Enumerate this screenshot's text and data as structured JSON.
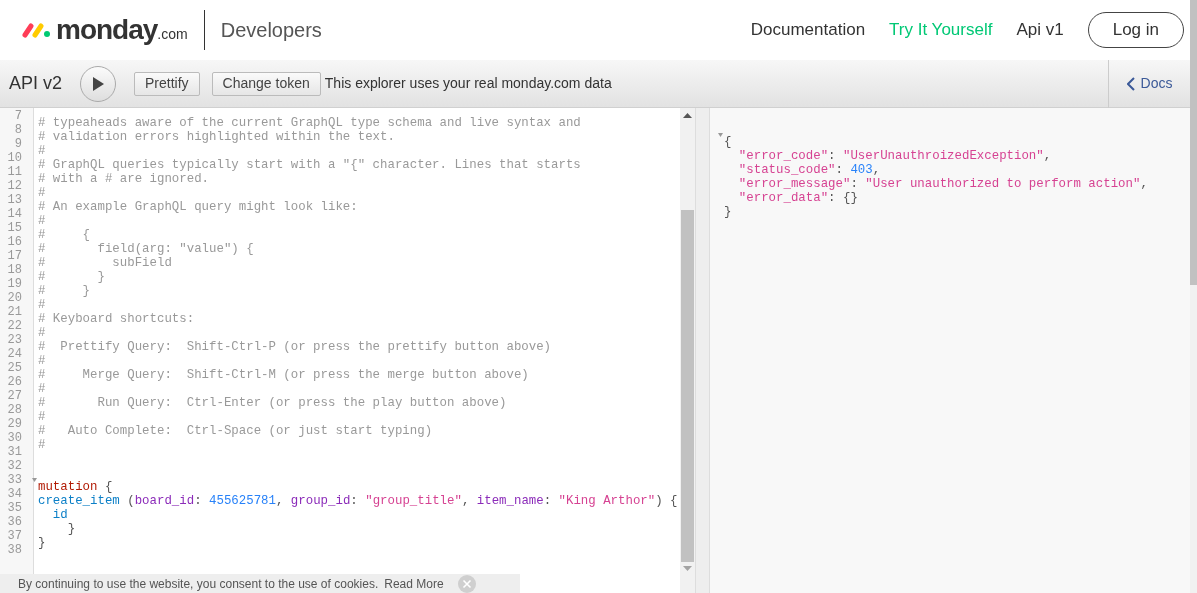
{
  "header": {
    "logo": {
      "name": "monday",
      "suffix": ".com"
    },
    "section": "Developers",
    "nav": [
      {
        "label": "Documentation",
        "selected": false
      },
      {
        "label": "Try It Yourself",
        "selected": true
      },
      {
        "label": "Api v1",
        "selected": false
      }
    ],
    "login": "Log in"
  },
  "toolbar": {
    "title": "API v2",
    "buttons": [
      "Prettify",
      "Change token"
    ],
    "notice": "This explorer uses your real monday.com data",
    "docs": "Docs"
  },
  "editor": {
    "lines": [
      {
        "number": "7",
        "fold": false,
        "tokens": [
          {
            "kind": "comment",
            "text": "# typeaheads aware of the current GraphQL type schema and live syntax and"
          }
        ]
      },
      {
        "number": "8",
        "fold": false,
        "tokens": [
          {
            "kind": "comment",
            "text": "# validation errors highlighted within the text."
          }
        ]
      },
      {
        "number": "9",
        "fold": false,
        "tokens": [
          {
            "kind": "comment",
            "text": "#"
          }
        ]
      },
      {
        "number": "10",
        "fold": false,
        "tokens": [
          {
            "kind": "comment",
            "text": "# GraphQL queries typically start with a \"{\" character. Lines that starts"
          }
        ]
      },
      {
        "number": "11",
        "fold": false,
        "tokens": [
          {
            "kind": "comment",
            "text": "# with a # are ignored."
          }
        ]
      },
      {
        "number": "12",
        "fold": false,
        "tokens": [
          {
            "kind": "comment",
            "text": "#"
          }
        ]
      },
      {
        "number": "13",
        "fold": false,
        "tokens": [
          {
            "kind": "comment",
            "text": "# An example GraphQL query might look like:"
          }
        ]
      },
      {
        "number": "14",
        "fold": false,
        "tokens": [
          {
            "kind": "comment",
            "text": "#"
          }
        ]
      },
      {
        "number": "15",
        "fold": false,
        "tokens": [
          {
            "kind": "comment",
            "text": "#     {"
          }
        ]
      },
      {
        "number": "16",
        "fold": false,
        "tokens": [
          {
            "kind": "comment",
            "text": "#       field(arg: \"value\") {"
          }
        ]
      },
      {
        "number": "17",
        "fold": false,
        "tokens": [
          {
            "kind": "comment",
            "text": "#         subField"
          }
        ]
      },
      {
        "number": "18",
        "fold": false,
        "tokens": [
          {
            "kind": "comment",
            "text": "#       }"
          }
        ]
      },
      {
        "number": "19",
        "fold": false,
        "tokens": [
          {
            "kind": "comment",
            "text": "#     }"
          }
        ]
      },
      {
        "number": "20",
        "fold": false,
        "tokens": [
          {
            "kind": "comment",
            "text": "#"
          }
        ]
      },
      {
        "number": "21",
        "fold": false,
        "tokens": [
          {
            "kind": "comment",
            "text": "# Keyboard shortcuts:"
          }
        ]
      },
      {
        "number": "22",
        "fold": false,
        "tokens": [
          {
            "kind": "comment",
            "text": "#"
          }
        ]
      },
      {
        "number": "23",
        "fold": false,
        "tokens": [
          {
            "kind": "comment",
            "text": "#  Prettify Query:  Shift-Ctrl-P (or press the prettify button above)"
          }
        ]
      },
      {
        "number": "24",
        "fold": false,
        "tokens": [
          {
            "kind": "comment",
            "text": "#"
          }
        ]
      },
      {
        "number": "25",
        "fold": false,
        "tokens": [
          {
            "kind": "comment",
            "text": "#     Merge Query:  Shift-Ctrl-M (or press the merge button above)"
          }
        ]
      },
      {
        "number": "26",
        "fold": false,
        "tokens": [
          {
            "kind": "comment",
            "text": "#"
          }
        ]
      },
      {
        "number": "27",
        "fold": false,
        "tokens": [
          {
            "kind": "comment",
            "text": "#       Run Query:  Ctrl-Enter (or press the play button above)"
          }
        ]
      },
      {
        "number": "28",
        "fold": false,
        "tokens": [
          {
            "kind": "comment",
            "text": "#"
          }
        ]
      },
      {
        "number": "29",
        "fold": false,
        "tokens": [
          {
            "kind": "comment",
            "text": "#   Auto Complete:  Ctrl-Space (or just start typing)"
          }
        ]
      },
      {
        "number": "30",
        "fold": false,
        "tokens": [
          {
            "kind": "comment",
            "text": "#"
          }
        ]
      },
      {
        "number": "31",
        "fold": false
      },
      {
        "number": "32",
        "fold": false
      },
      {
        "number": "33",
        "fold": true,
        "tokens": [
          {
            "kind": "keyword",
            "text": "mutation"
          },
          {
            "kind": "punct",
            "text": " {"
          }
        ]
      },
      {
        "number": "34",
        "fold": false,
        "tokens": [
          {
            "kind": "def",
            "text": "create_item"
          },
          {
            "kind": "punct",
            "text": " ("
          },
          {
            "kind": "attribute",
            "text": "board_id"
          },
          {
            "kind": "punct",
            "text": ": "
          },
          {
            "kind": "number",
            "text": "455625781"
          },
          {
            "kind": "punct",
            "text": ", "
          },
          {
            "kind": "attribute",
            "text": "group_id"
          },
          {
            "kind": "punct",
            "text": ": "
          },
          {
            "kind": "string",
            "text": "\"group_title\""
          },
          {
            "kind": "punct",
            "text": ", "
          },
          {
            "kind": "attribute",
            "text": "item_name"
          },
          {
            "kind": "punct",
            "text": ": "
          },
          {
            "kind": "string",
            "text": "\"King Arthor\""
          },
          {
            "kind": "punct",
            "text": ") {"
          }
        ]
      },
      {
        "number": "35",
        "fold": false,
        "tokens": [
          {
            "kind": "def",
            "text": "  id"
          }
        ]
      },
      {
        "number": "36",
        "fold": false,
        "tokens": [
          {
            "kind": "punct",
            "text": "    }"
          }
        ]
      },
      {
        "number": "37",
        "fold": false,
        "tokens": [
          {
            "kind": "punct",
            "text": "}"
          }
        ]
      },
      {
        "number": "38",
        "fold": false
      }
    ]
  },
  "result": {
    "lines": [
      {
        "fold": true,
        "tokens": [
          {
            "kind": "punct",
            "text": "{"
          }
        ]
      },
      {
        "fold": false,
        "tokens": [
          {
            "kind": "string",
            "text": "  \"error_code\""
          },
          {
            "kind": "punct",
            "text": ": "
          },
          {
            "kind": "string",
            "text": "\"UserUnauthroizedException\""
          },
          {
            "kind": "punct",
            "text": ","
          }
        ]
      },
      {
        "fold": false,
        "tokens": [
          {
            "kind": "string",
            "text": "  \"status_code\""
          },
          {
            "kind": "punct",
            "text": ": "
          },
          {
            "kind": "number",
            "text": "403"
          },
          {
            "kind": "punct",
            "text": ","
          }
        ]
      },
      {
        "fold": false,
        "tokens": [
          {
            "kind": "string",
            "text": "  \"error_message\""
          },
          {
            "kind": "punct",
            "text": ": "
          },
          {
            "kind": "string",
            "text": "\"User unauthorized to perform action\""
          },
          {
            "kind": "punct",
            "text": ","
          }
        ]
      },
      {
        "fold": false,
        "tokens": [
          {
            "kind": "string",
            "text": "  \"error_data\""
          },
          {
            "kind": "punct",
            "text": ": {}"
          }
        ]
      },
      {
        "fold": false,
        "tokens": [
          {
            "kind": "punct",
            "text": "}"
          }
        ]
      }
    ]
  },
  "cookie_banner": {
    "text": "By continuing to use the website, you consent to the use of cookies.",
    "link": "Read More"
  }
}
